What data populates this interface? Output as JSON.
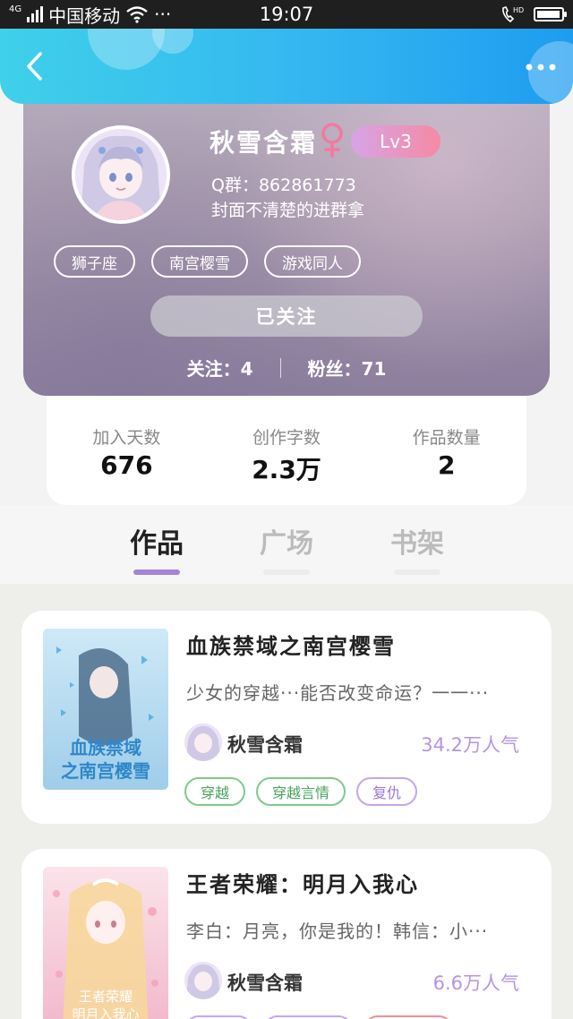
{
  "status_bar": {
    "network": "4G",
    "carrier": "中国移动",
    "more": "···",
    "time": "19:07",
    "hd": "HD",
    "battery_level": 0.95
  },
  "header": {
    "back_icon": "chevron-left-icon",
    "more_icon": "more-dots-icon"
  },
  "profile": {
    "username": "秋雪含霜",
    "gender_symbol": "♀",
    "level": "Lv3",
    "qq_group": "Q群：862861773",
    "bio": "封面不清楚的进群拿",
    "chips": [
      "狮子座",
      "南宫樱雪",
      "游戏同人"
    ],
    "follow_button": "已关注",
    "following": "关注：4",
    "fans": "粉丝：71"
  },
  "stats": [
    {
      "label": "加入天数",
      "value": "676"
    },
    {
      "label": "创作字数",
      "value": "2.3万"
    },
    {
      "label": "作品数量",
      "value": "2"
    }
  ],
  "tabs": [
    {
      "label": "作品",
      "active": true
    },
    {
      "label": "广场",
      "active": false
    },
    {
      "label": "书架",
      "active": false
    }
  ],
  "books": [
    {
      "title": "血族禁域之南宫樱雪",
      "description": "少女的穿越···能否改变命运？一一···",
      "author": "秋雪含霜",
      "popularity": "34.2万人气",
      "tags": [
        {
          "label": "穿越",
          "color": "green"
        },
        {
          "label": "穿越言情",
          "color": "green"
        },
        {
          "label": "复仇",
          "color": "purple"
        }
      ],
      "cover_text": [
        "血族禁域",
        "之南宫樱雪"
      ]
    },
    {
      "title": "王者荣耀：明月入我心",
      "description": "李白：月亮，你是我的！韩信：小···",
      "author": "秋雪含霜",
      "popularity": "6.6万人气",
      "tags": [
        {
          "label": "",
          "color": "purple"
        },
        {
          "label": "",
          "color": "purple"
        },
        {
          "label": "",
          "color": "red"
        }
      ],
      "cover_text": [
        "王者荣耀",
        "明月入我心"
      ]
    }
  ],
  "colors": {
    "header_blue": "#34b6f0",
    "accent_purple": "#a583d8",
    "popularity": "#b594e6",
    "level_gradient_start": "#d7a4e6",
    "level_gradient_end": "#f58aa4"
  }
}
